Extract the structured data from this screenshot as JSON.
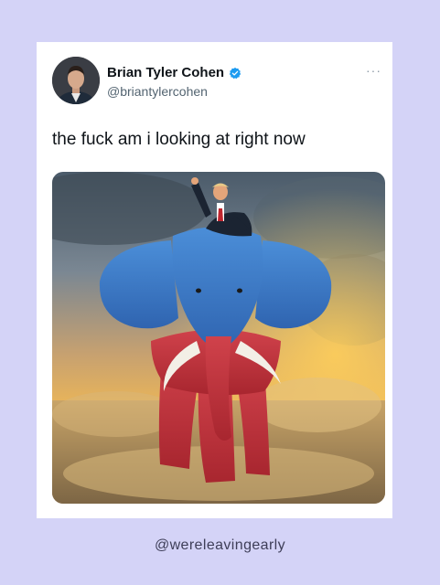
{
  "tweet": {
    "display_name": "Brian Tyler Cohen",
    "handle": "@briantylercohen",
    "verified": true,
    "more_icon": "more-dots-icon",
    "text": "the fuck am i looking at right now"
  },
  "watermark": {
    "text": "@wereleavingearly"
  },
  "colors": {
    "page_background": "#d4d3f7",
    "card_background": "#ffffff",
    "verified_blue": "#1d9bf0",
    "text_primary": "#0f1419",
    "text_secondary": "#536471"
  }
}
